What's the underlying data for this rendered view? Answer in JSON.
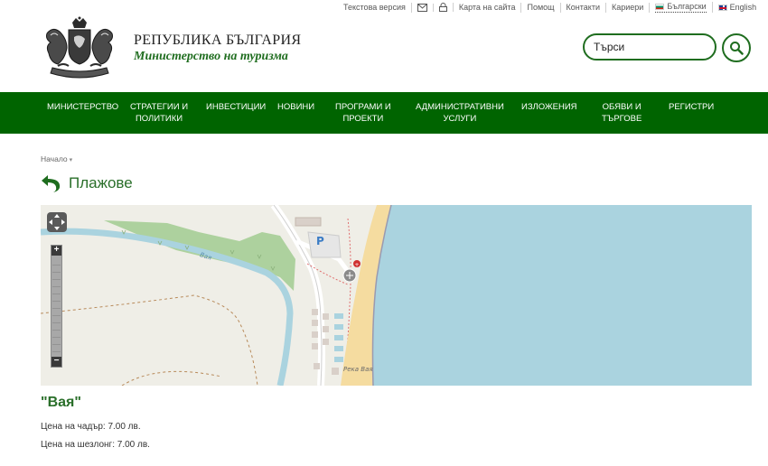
{
  "topbar": {
    "text_version": "Текстова версия",
    "sitemap": "Карта на сайта",
    "help": "Помощ",
    "contacts": "Контакти",
    "careers": "Кариери",
    "lang_bg": "Български",
    "lang_en": "English"
  },
  "header": {
    "title": "РЕПУБЛИКА БЪЛГАРИЯ",
    "subtitle": "Министерство на туризма",
    "search_placeholder": "Търси"
  },
  "nav": {
    "items": [
      {
        "line1": "МИНИСТЕРСТВО",
        "line2": ""
      },
      {
        "line1": "СТРАТЕГИИ И",
        "line2": "ПОЛИТИКИ"
      },
      {
        "line1": "ИНВЕСТИЦИИ",
        "line2": ""
      },
      {
        "line1": "НОВИНИ",
        "line2": ""
      },
      {
        "line1": "ПРОГРАМИ И",
        "line2": "ПРОЕКТИ"
      },
      {
        "line1": "АДМИНИСТРАТИВНИ",
        "line2": "УСЛУГИ"
      },
      {
        "line1": "ИЗЛОЖЕНИЯ",
        "line2": ""
      },
      {
        "line1": "ОБЯВИ И",
        "line2": "ТЪРГОВЕ"
      },
      {
        "line1": "РЕГИСТРИ",
        "line2": ""
      }
    ]
  },
  "breadcrumb": {
    "home": "Начало",
    "caret": "▾"
  },
  "page": {
    "title": "Плажове"
  },
  "map": {
    "river_label": "Вая",
    "river_label_2": "Река Вая",
    "parking_label": "P",
    "zoom_in": "+",
    "zoom_out": "−",
    "colors": {
      "sea": "#aad3df",
      "land": "#efeee7",
      "park": "#add19e",
      "sand": "#f5dca0",
      "river": "#aad3df"
    }
  },
  "beach": {
    "name": "\"Вая\"",
    "umbrella_price": "Цена на чадър: 7.00 лв.",
    "sunbed_price": "Цена на шезлонг: 7.00 лв."
  },
  "icons": {
    "email": "email-icon",
    "lock": "lock-icon",
    "search": "search-icon",
    "back": "back-arrow-icon",
    "coat_of_arms": "coat-of-arms-icon"
  }
}
